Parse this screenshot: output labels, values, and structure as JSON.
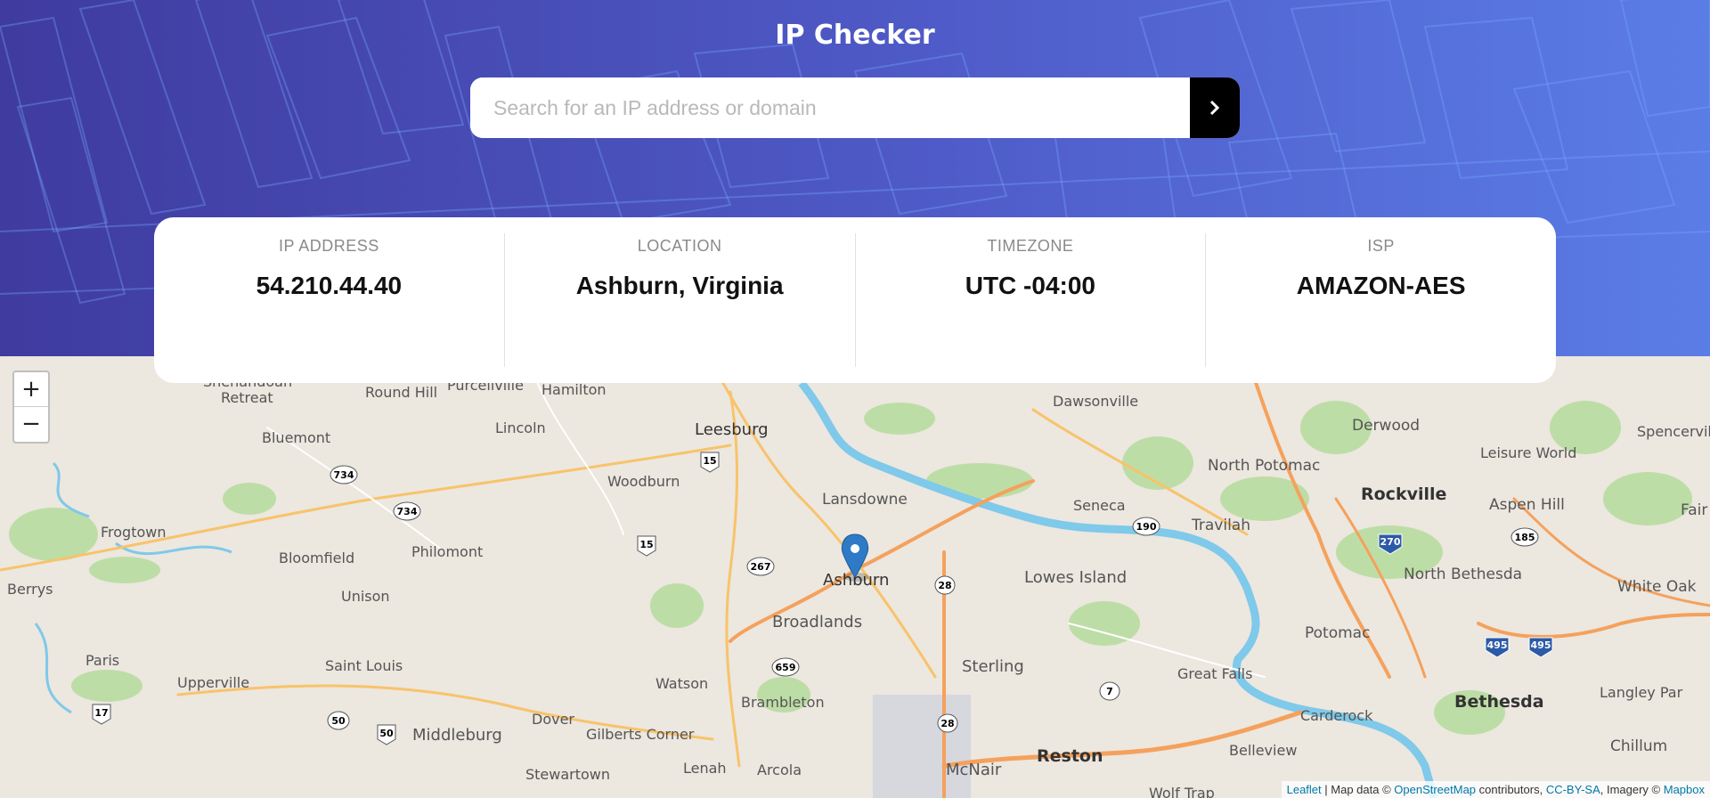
{
  "header": {
    "title": "IP Checker",
    "search_placeholder": "Search for an IP address or domain"
  },
  "info": {
    "ip_label": "IP ADDRESS",
    "ip_value": "54.210.44.40",
    "location_label": "LOCATION",
    "location_value": "Ashburn, Virginia",
    "timezone_label": "TIMEZONE",
    "timezone_value": "UTC -04:00",
    "isp_label": "ISP",
    "isp_value": "AMAZON-AES"
  },
  "map": {
    "zoom_in": "+",
    "zoom_out": "−",
    "attribution": {
      "leaflet": "Leaflet",
      "sep1": " | Map data © ",
      "osm": "OpenStreetMap",
      "sep2": " contributors, ",
      "license": "CC-BY-SA",
      "sep3": ", Imagery © ",
      "mapbox": "Mapbox"
    },
    "places": [
      {
        "name": "Round Hill"
      },
      {
        "name": "Purcellville"
      },
      {
        "name": "Hamilton"
      },
      {
        "name": "Retreat"
      },
      {
        "name": "Bluemont"
      },
      {
        "name": "Lincoln"
      },
      {
        "name": "Leesburg"
      },
      {
        "name": "Woodburn"
      },
      {
        "name": "Frogtown"
      },
      {
        "name": "Philomont"
      },
      {
        "name": "Bloomfield"
      },
      {
        "name": "Unison"
      },
      {
        "name": "Berrys"
      },
      {
        "name": "Paris"
      },
      {
        "name": "Saint Louis"
      },
      {
        "name": "Upperville"
      },
      {
        "name": "Watson"
      },
      {
        "name": "Dover"
      },
      {
        "name": "Gilberts Corner"
      },
      {
        "name": "Middleburg"
      },
      {
        "name": "Stewartown"
      },
      {
        "name": "Lenah"
      },
      {
        "name": "Arcola"
      },
      {
        "name": "Brambleton"
      },
      {
        "name": "Broadlands"
      },
      {
        "name": "Ashburn"
      },
      {
        "name": "Lansdowne"
      },
      {
        "name": "Dawsonville"
      },
      {
        "name": "Seneca"
      },
      {
        "name": "Lowes Island"
      },
      {
        "name": "Sterling"
      },
      {
        "name": "Travilah"
      },
      {
        "name": "North Potomac"
      },
      {
        "name": "Derwood"
      },
      {
        "name": "Rockville"
      },
      {
        "name": "Leisure World"
      },
      {
        "name": "Aspen Hill"
      },
      {
        "name": "Spencervil"
      },
      {
        "name": "North Bethesda"
      },
      {
        "name": "White Oak"
      },
      {
        "name": "Potomac"
      },
      {
        "name": "Great Falls"
      },
      {
        "name": "Carderock"
      },
      {
        "name": "Bethesda"
      },
      {
        "name": "Belleview"
      },
      {
        "name": "Reston"
      },
      {
        "name": "McNair"
      },
      {
        "name": "Langley Par"
      },
      {
        "name": "Chillum"
      },
      {
        "name": "Wolf Trap"
      },
      {
        "name": "Fair"
      },
      {
        "name": "Shenandoah"
      }
    ],
    "shields": [
      "734",
      "734",
      "15",
      "15",
      "267",
      "659",
      "28",
      "28",
      "7",
      "190",
      "185",
      "270",
      "495",
      "495",
      "17",
      "50",
      "50"
    ]
  }
}
